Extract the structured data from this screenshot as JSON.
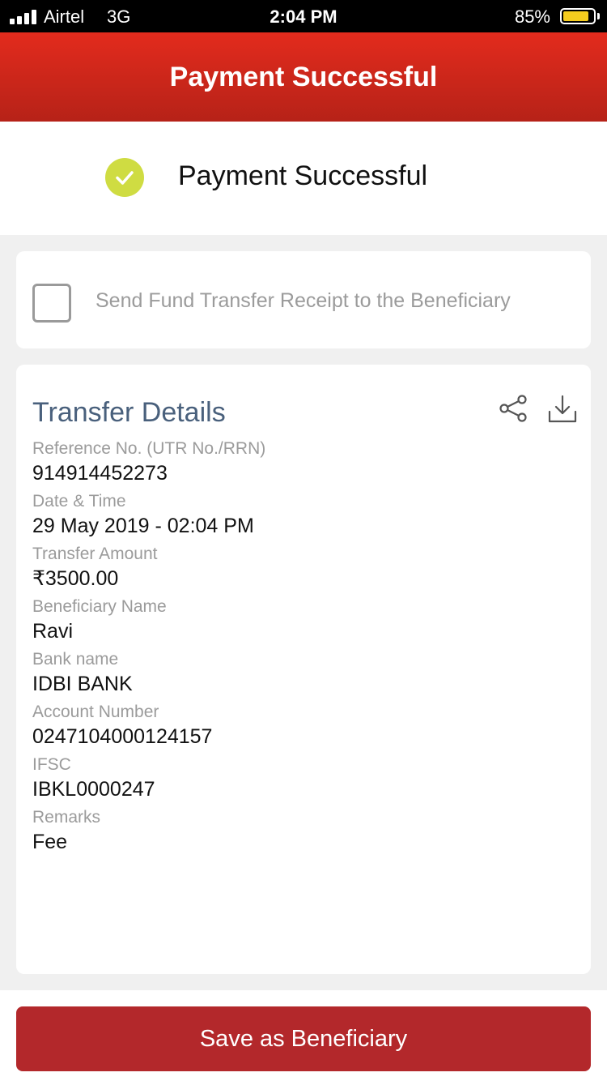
{
  "status_bar": {
    "carrier": "Airtel",
    "network": "3G",
    "time": "2:04 PM",
    "battery_percent": "85%",
    "battery_level": 0.85,
    "battery_color": "#f5cc1e"
  },
  "header": {
    "title": "Payment Successful"
  },
  "success": {
    "message": "Payment Successful",
    "icon": "check-circle-icon",
    "icon_color": "#cfdc42"
  },
  "receipt": {
    "checked": false,
    "label": "Send Fund Transfer Receipt to the Beneficiary"
  },
  "transfer_details": {
    "title": "Transfer Details",
    "share_icon": "share-icon",
    "download_icon": "download-icon",
    "fields": [
      {
        "label": "Reference No. (UTR No./RRN)",
        "value": "914914452273"
      },
      {
        "label": "Date & Time",
        "value": "29 May 2019 - 02:04 PM"
      },
      {
        "label": "Transfer Amount",
        "value": "₹3500.00"
      },
      {
        "label": "Beneficiary Name",
        "value": "Ravi"
      },
      {
        "label": "Bank name",
        "value": "IDBI BANK"
      },
      {
        "label": "Account Number",
        "value": "0247104000124157"
      },
      {
        "label": "IFSC",
        "value": "IBKL0000247"
      },
      {
        "label": "Remarks",
        "value": "Fee"
      }
    ]
  },
  "footer": {
    "save_button_label": "Save as Beneficiary",
    "button_color": "#b3282b"
  }
}
